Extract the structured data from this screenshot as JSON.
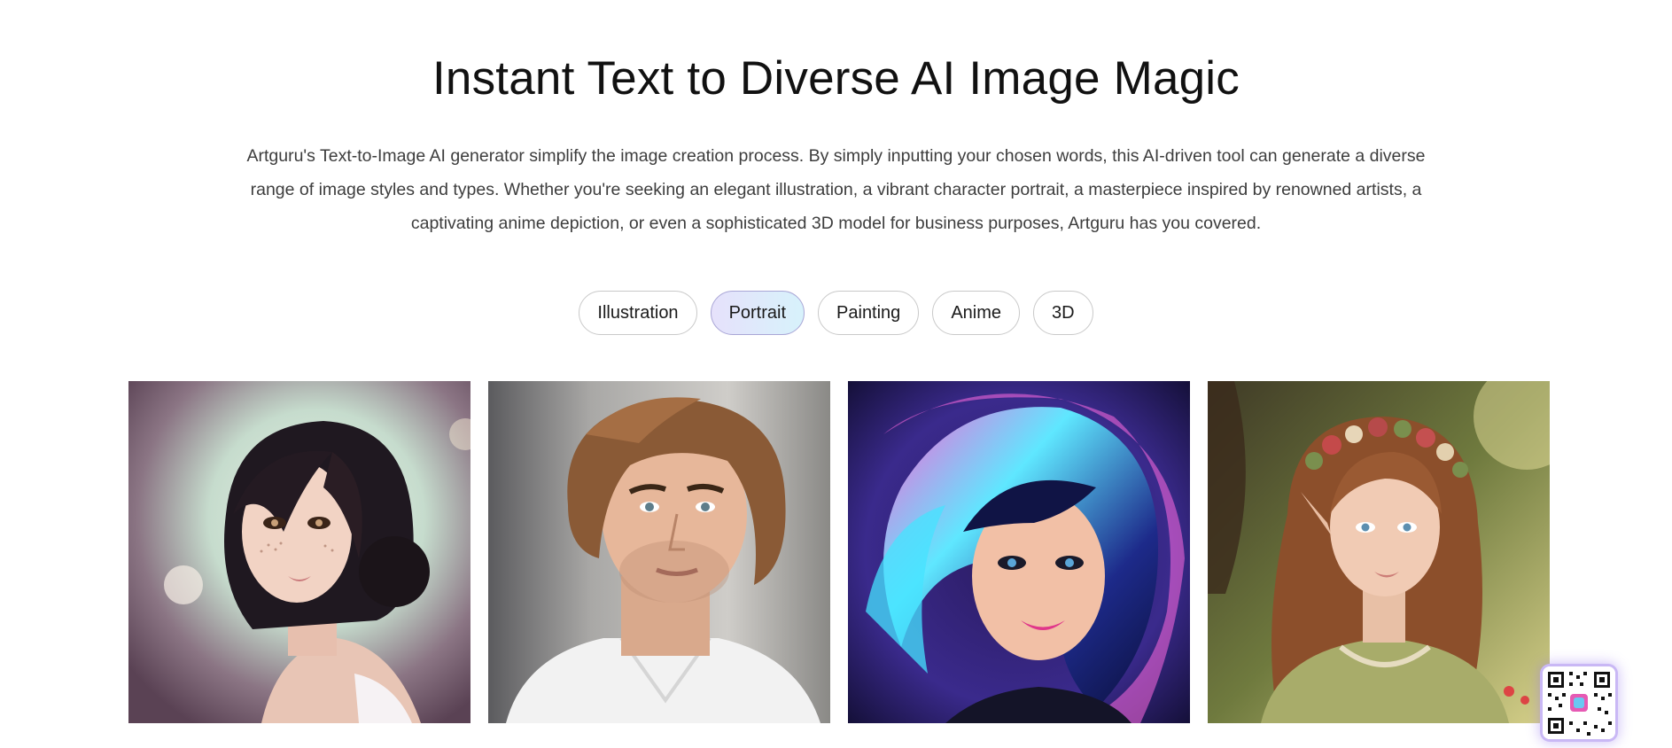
{
  "header": {
    "title": "Instant Text to Diverse AI Image Magic",
    "description": "Artguru's Text-to-Image AI generator simplify the image creation process. By simply inputting your chosen words, this AI-driven tool can generate a diverse range of image styles and types. Whether you're seeking an elegant illustration, a vibrant character portrait, a masterpiece inspired by renowned artists, a captivating anime depiction, or even a sophisticated 3D model for business purposes, Artguru has you covered."
  },
  "tabs": [
    {
      "label": "Illustration",
      "active": false
    },
    {
      "label": "Portrait",
      "active": true
    },
    {
      "label": "Painting",
      "active": false
    },
    {
      "label": "Anime",
      "active": false
    },
    {
      "label": "3D",
      "active": false
    }
  ],
  "gallery": {
    "images": [
      {
        "icon": "portrait-woman-freckles-image"
      },
      {
        "icon": "portrait-man-curly-hair-image"
      },
      {
        "icon": "portrait-woman-neon-hair-image"
      },
      {
        "icon": "portrait-elf-girl-flower-crown-image"
      }
    ]
  },
  "qr": {
    "icon": "qr-code-icon"
  },
  "colors": {
    "active_tab_gradient_start": "#e6e1fb",
    "active_tab_gradient_end": "#d7f2fb",
    "qr_glow": "#c9b8f5"
  }
}
